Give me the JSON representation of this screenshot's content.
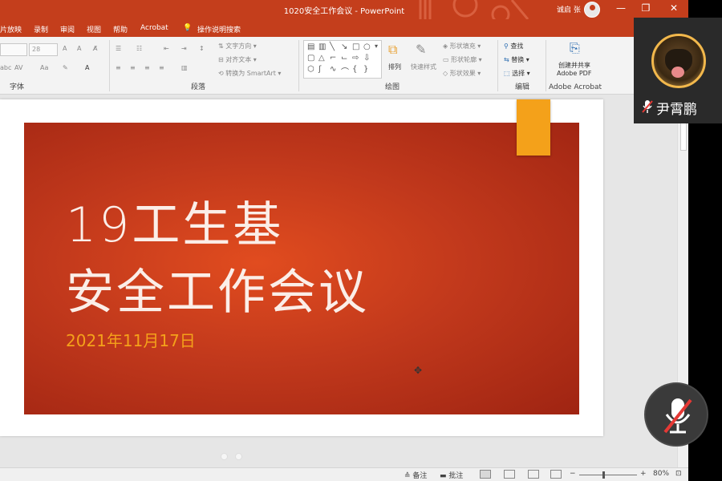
{
  "window": {
    "title": "1020安全工作会议 - PowerPoint",
    "user": "诚启 张",
    "btn_minimize": "—",
    "btn_restore": "❐",
    "btn_close": "✕"
  },
  "menu": {
    "items": [
      "片放映",
      "录制",
      "审阅",
      "视图",
      "帮助",
      "Acrobat"
    ],
    "tell_me": "操作说明搜索"
  },
  "ribbon": {
    "font_size_value": "28",
    "group_font": "字体",
    "group_paragraph": "段落",
    "group_drawing": "绘图",
    "group_edit": "编辑",
    "group_acrobat": "Adobe Acrobat",
    "text_direction": "文字方向",
    "align_text": "对齐文本",
    "convert_smartart": "转换为 SmartArt",
    "arrange": "排列",
    "quick_styles": "快速样式",
    "shape_fill": "形状填充",
    "shape_outline": "形状轮廓",
    "shape_effects": "形状效果",
    "find": "查找",
    "replace": "替换",
    "select": "选择",
    "create_share_pdf_line1": "创建并共享",
    "create_share_pdf_line2": "Adobe PDF"
  },
  "slide": {
    "title_line1": "19工生基",
    "title_line2": "安全工作会议",
    "date": "2021年11月17日"
  },
  "status": {
    "notes": "备注",
    "comments": "批注",
    "zoom_minus": "−",
    "zoom_plus": "+",
    "zoom": "80%"
  },
  "meeting": {
    "participant_name": "尹霄鹏"
  },
  "colors": {
    "accent": "#c43e1c",
    "slide_bg": "#c2391c",
    "orange": "#f4a11a"
  }
}
